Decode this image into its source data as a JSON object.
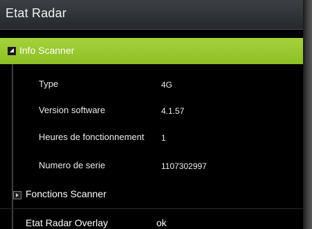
{
  "window": {
    "title": "Etat Radar"
  },
  "sections": {
    "info_scanner": {
      "label": "Info Scanner",
      "expanded": true,
      "rows": [
        {
          "label": "Type",
          "value": "4G"
        },
        {
          "label": "Version software",
          "value": "4.1.57"
        },
        {
          "label": "Heures de fonctionnement",
          "value": "1"
        },
        {
          "label": "Numero de serie",
          "value": "1107302997"
        }
      ]
    },
    "fonctions_scanner": {
      "label": "Fonctions Scanner",
      "expanded": false
    },
    "overlay": {
      "label": "Etat Radar Overlay",
      "value": "ok"
    }
  },
  "colors": {
    "selected_row": "#9ccb30",
    "titlebar": "#2f3235",
    "background": "#000000"
  },
  "icons": {
    "expanded": "triangle-down-icon",
    "collapsed": "triangle-right-icon"
  }
}
